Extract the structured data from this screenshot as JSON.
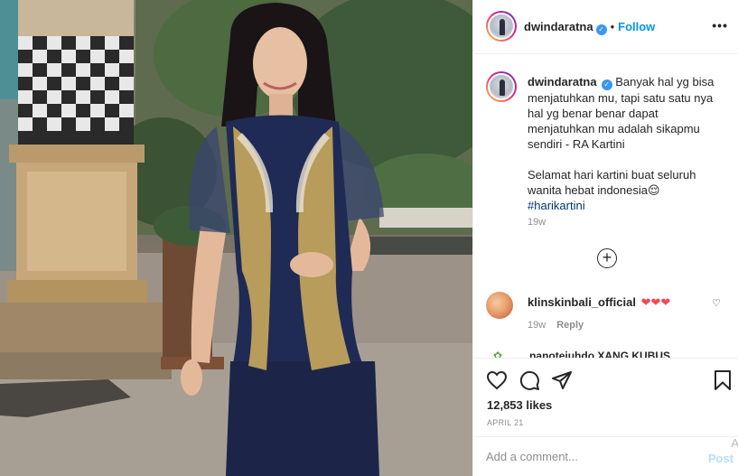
{
  "header": {
    "username": "dwindaratna",
    "separator": "•",
    "follow_label": "Follow",
    "more_label": "•••"
  },
  "caption": {
    "username": "dwindaratna",
    "lines": [
      "Banyak hal yg bisa",
      "menjatuhkan mu, tapi satu satu nya",
      "hal yg benar benar dapat",
      "menjatuhkan mu adalah sikapmu",
      "sendiri - RA Kartini"
    ],
    "lines2": [
      "Selamat hari kartini buat seluruh",
      "wanita hebat indonesia😌"
    ],
    "hashtag": "#harikartini",
    "time": "19w"
  },
  "load_more_icon": "plus-circle-icon",
  "comment": {
    "username": "klinskinbali_official",
    "hearts": "❤❤❤",
    "time": "19w",
    "reply_label": "Reply",
    "like_icon": "heart-outline-icon"
  },
  "next_comment_partial": "nanotejuhdo XANG KUBUS",
  "actions": {
    "icons": [
      "heart-icon",
      "comment-icon",
      "share-icon",
      "bookmark-icon"
    ],
    "likes": "12,853 likes",
    "date": "APRIL 21"
  },
  "comment_box": {
    "placeholder": "Add a comment...",
    "post_label": "Post"
  },
  "edge_glyph": "A",
  "colors": {
    "accent_blue": "#0095f6",
    "verified_blue": "#3897f0",
    "heart_red": "#ed4956",
    "dress_navy": "#1f2a55",
    "lace_gold": "#c8a85c"
  }
}
